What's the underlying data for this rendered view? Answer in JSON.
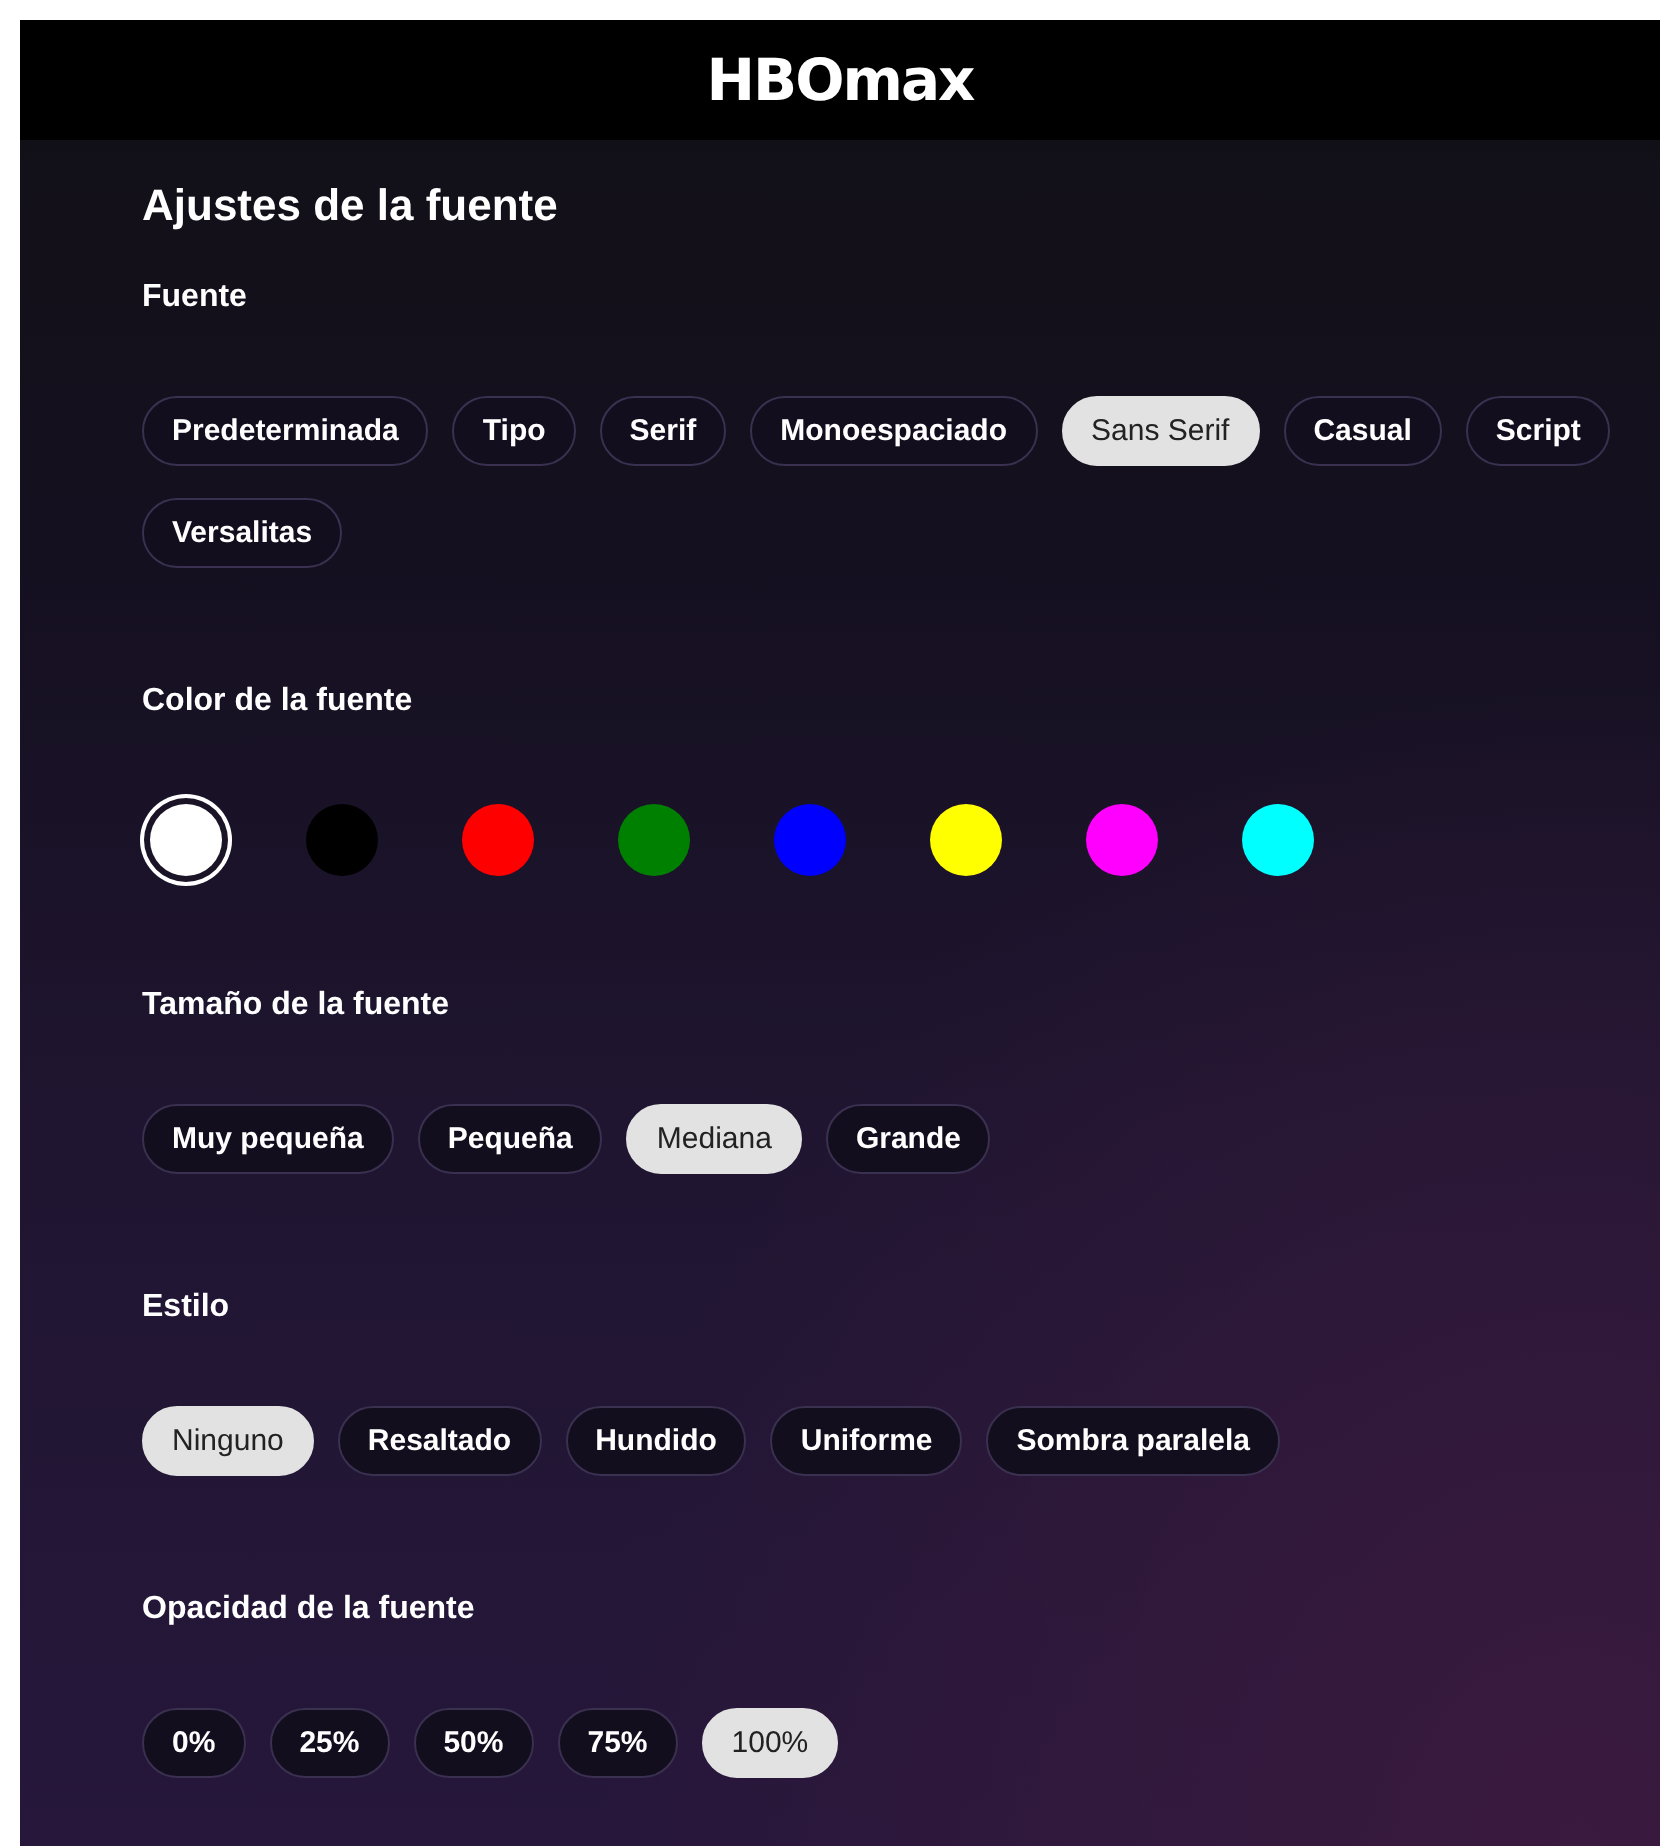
{
  "header": {
    "logo": "HBOmax"
  },
  "title": "Ajustes de la fuente",
  "sections": [
    {
      "kind": "chips",
      "heading": "Fuente",
      "options": [
        {
          "label": "Predeterminada",
          "selected": false
        },
        {
          "label": "Tipo",
          "selected": false
        },
        {
          "label": "Serif",
          "selected": false
        },
        {
          "label": "Monoespaciado",
          "selected": false
        },
        {
          "label": "Sans Serif",
          "selected": true
        },
        {
          "label": "Casual",
          "selected": false
        },
        {
          "label": "Script",
          "selected": false
        },
        {
          "label": "Versalitas",
          "selected": false
        }
      ]
    },
    {
      "kind": "colors",
      "heading": "Color de la fuente",
      "options": [
        {
          "color": "#ffffff",
          "selected": true
        },
        {
          "color": "#000000",
          "selected": false
        },
        {
          "color": "#ff0000",
          "selected": false
        },
        {
          "color": "#008000",
          "selected": false
        },
        {
          "color": "#0000ff",
          "selected": false
        },
        {
          "color": "#ffff00",
          "selected": false
        },
        {
          "color": "#ff00ff",
          "selected": false
        },
        {
          "color": "#00ffff",
          "selected": false
        }
      ]
    },
    {
      "kind": "chips",
      "heading": "Tamaño de la fuente",
      "options": [
        {
          "label": "Muy pequeña",
          "selected": false
        },
        {
          "label": "Pequeña",
          "selected": false
        },
        {
          "label": "Mediana",
          "selected": true
        },
        {
          "label": "Grande",
          "selected": false
        }
      ]
    },
    {
      "kind": "chips",
      "heading": "Estilo",
      "options": [
        {
          "label": "Ninguno",
          "selected": true
        },
        {
          "label": "Resaltado",
          "selected": false
        },
        {
          "label": "Hundido",
          "selected": false
        },
        {
          "label": "Uniforme",
          "selected": false
        },
        {
          "label": "Sombra paralela",
          "selected": false
        }
      ]
    },
    {
      "kind": "chips",
      "heading": "Opacidad de la fuente",
      "options": [
        {
          "label": "0%",
          "selected": false
        },
        {
          "label": "25%",
          "selected": false
        },
        {
          "label": "50%",
          "selected": false
        },
        {
          "label": "75%",
          "selected": false
        },
        {
          "label": "100%",
          "selected": true
        }
      ]
    }
  ]
}
